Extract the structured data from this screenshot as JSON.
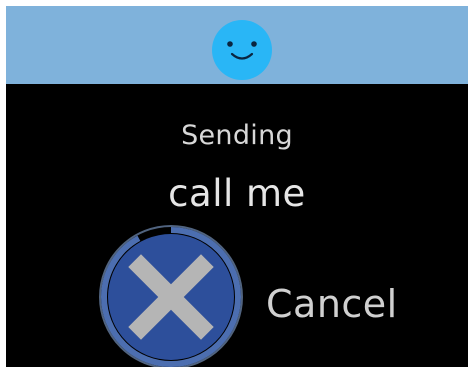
{
  "status": "Sending",
  "message": "call me",
  "cancel_label": "Cancel",
  "icons": {
    "avatar": "smiley-face-icon",
    "cancel": "close-x-icon"
  },
  "colors": {
    "header_bg": "#7fb2db",
    "screen_bg": "#000000",
    "avatar": "#29b6f6",
    "cancel_circle": "#2d4f9b",
    "cancel_x": "#b5b5b5"
  },
  "cancel_progress": 0.92
}
